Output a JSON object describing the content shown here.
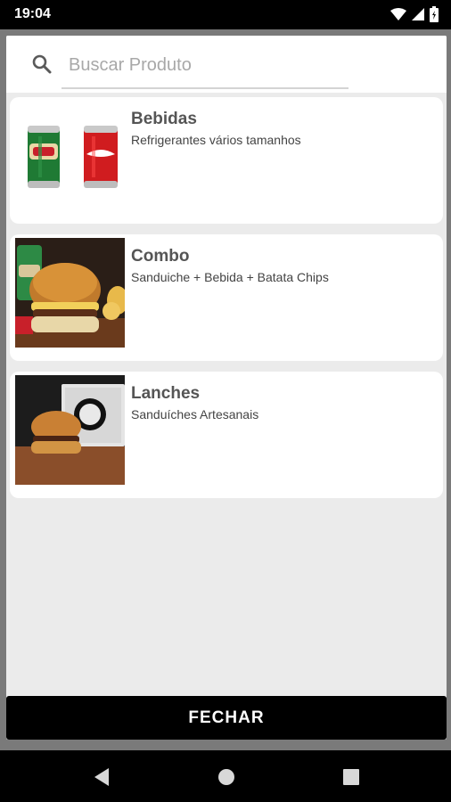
{
  "status_bar": {
    "time": "19:04",
    "icons": [
      "wifi-icon",
      "signal-icon",
      "battery-icon"
    ]
  },
  "search": {
    "placeholder": "Buscar Produto",
    "value": "",
    "icon": "search-icon"
  },
  "categories": [
    {
      "title": "Bebidas",
      "subtitle": "Refrigerantes vários tamanhos",
      "image": "soda-cans"
    },
    {
      "title": "Combo",
      "subtitle": "Sanduiche + Bebida + Batata Chips",
      "image": "burger-combo"
    },
    {
      "title": "Lanches",
      "subtitle": "Sanduíches Artesanais",
      "image": "burger"
    }
  ],
  "footer": {
    "close_label": "FECHAR"
  },
  "nav_bar": {
    "buttons": [
      "back-icon",
      "home-icon",
      "recents-icon"
    ]
  },
  "colors": {
    "panel_background": "#ebebeb",
    "card_background": "#ffffff",
    "button_background": "#000000",
    "title_text": "#555555"
  }
}
